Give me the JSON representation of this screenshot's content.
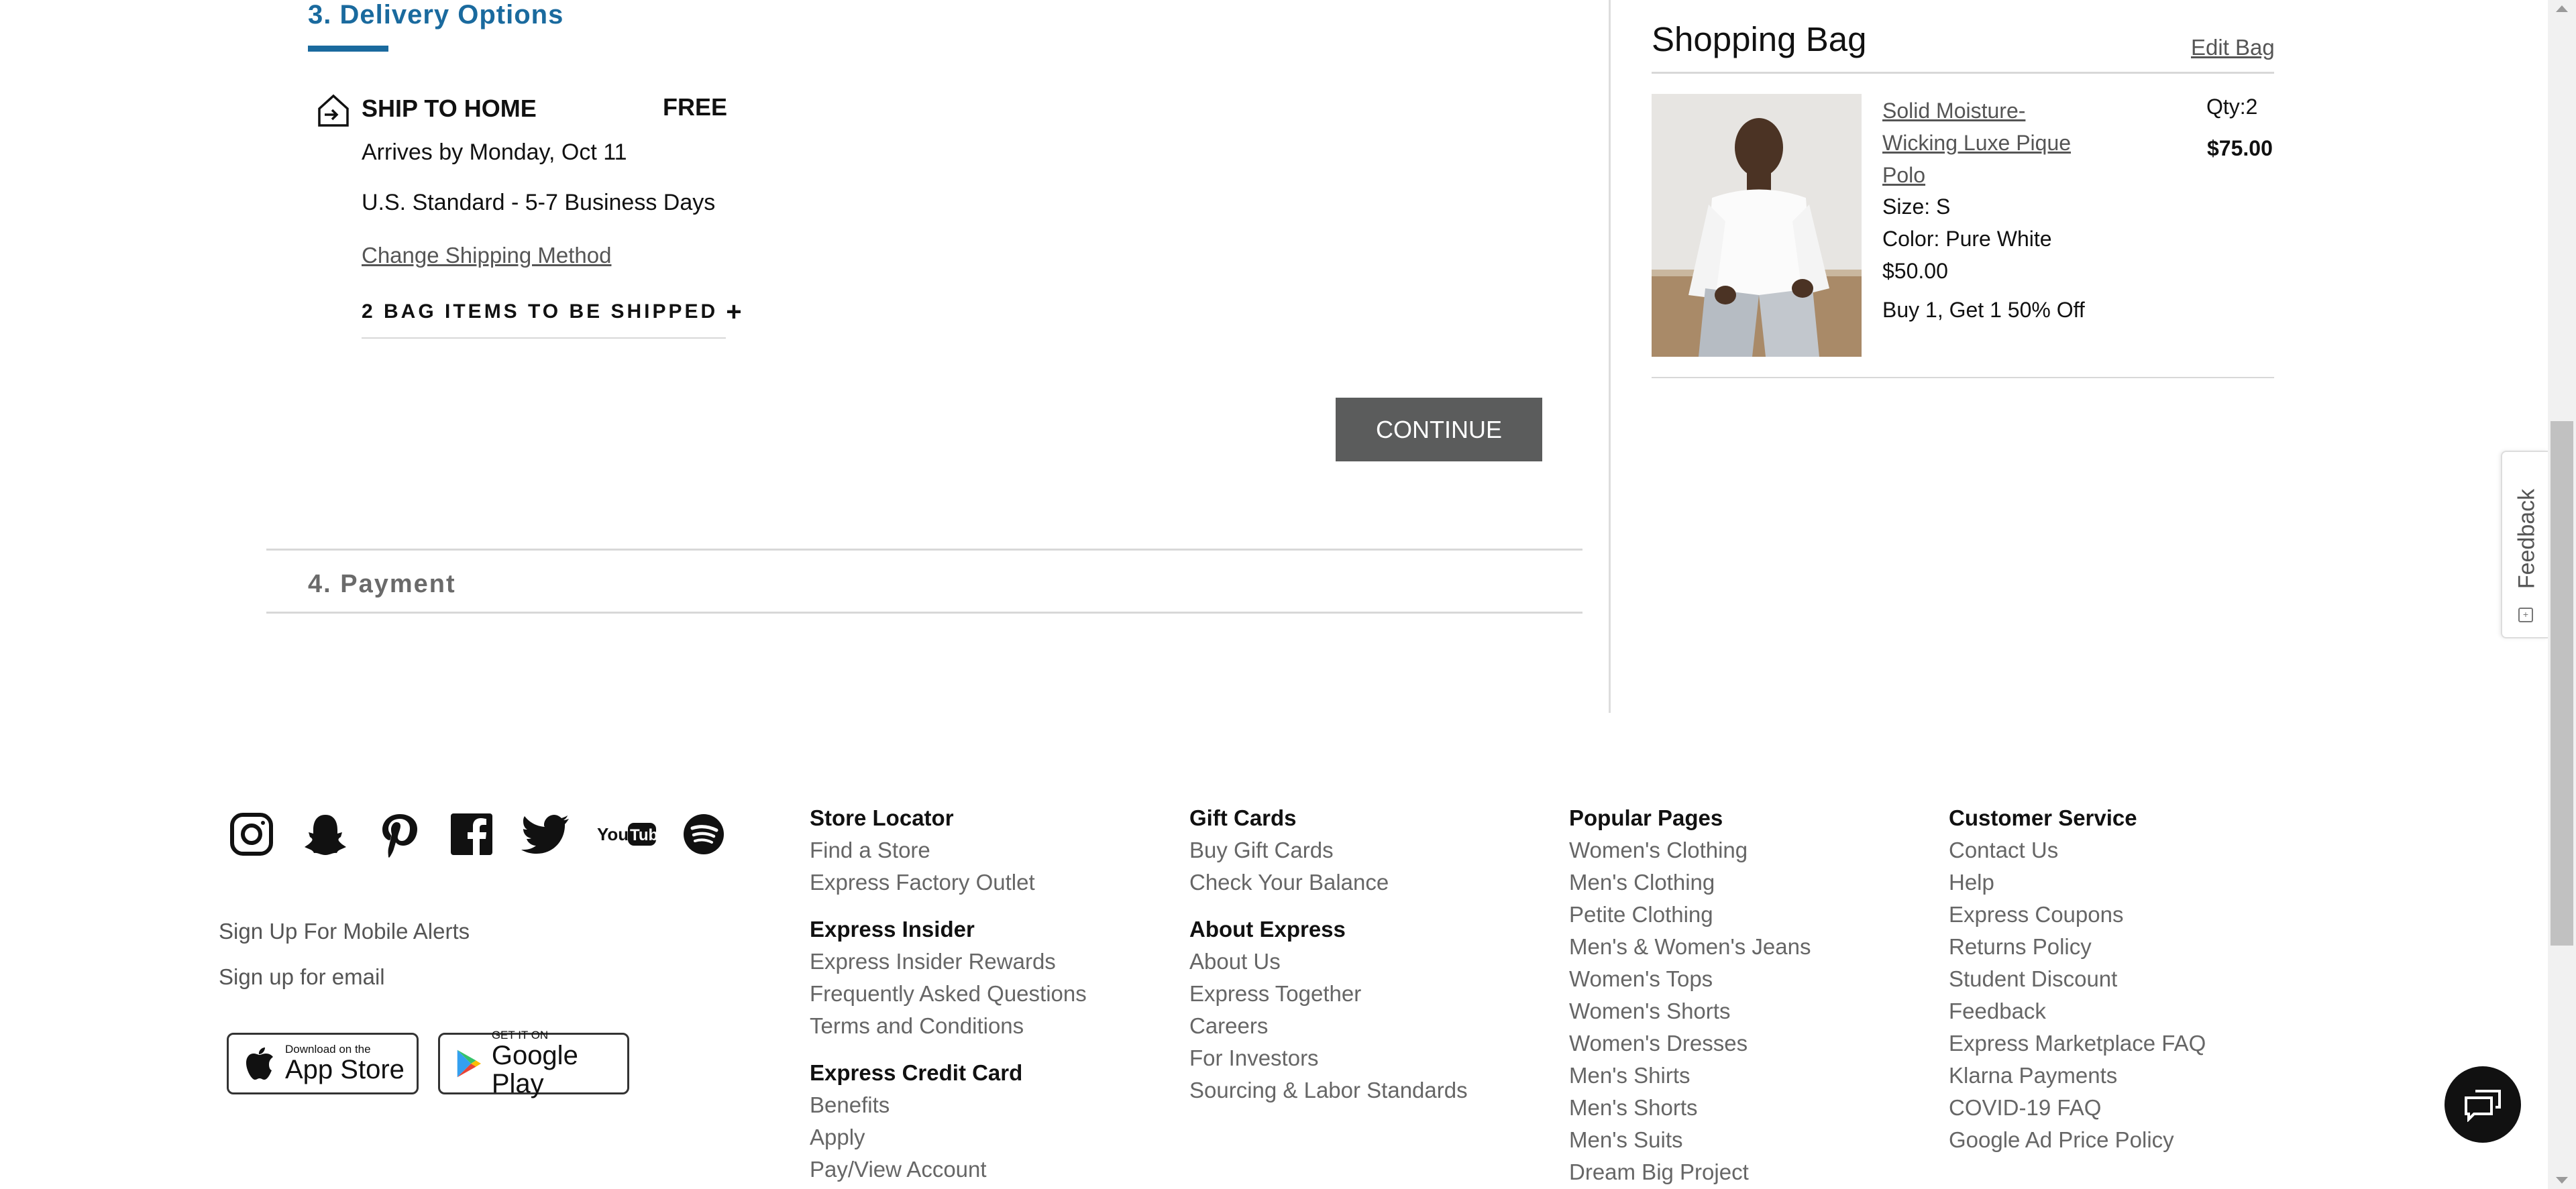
{
  "delivery": {
    "title": "3. Delivery Options",
    "ship_title": "SHIP TO HOME",
    "price": "FREE",
    "arrives": "Arrives by Monday, Oct 11",
    "method": "U.S. Standard - 5-7 Business Days",
    "change_link": "Change Shipping Method",
    "items_toggle": "2 BAG ITEMS TO BE SHIPPED",
    "continue": "CONTINUE"
  },
  "payment": {
    "title": "4. Payment"
  },
  "bag": {
    "title": "Shopping Bag",
    "edit": "Edit Bag",
    "item": {
      "name_line1": "Solid Moisture-",
      "name_line2": "Wicking Luxe Pique",
      "name_line3": "Polo",
      "size": "Size: S",
      "color": "Color: Pure White",
      "price": "$50.00",
      "promo": "Buy 1, Get 1 50% Off",
      "qty": "Qty:2",
      "total": "$75.00"
    }
  },
  "feedback": "Feedback",
  "footer": {
    "social_icons": [
      "instagram-icon",
      "snapchat-icon",
      "pinterest-icon",
      "facebook-icon",
      "twitter-icon",
      "youtube-icon",
      "spotify-icon"
    ],
    "mobile_alerts": "Sign Up For Mobile Alerts",
    "email": "Sign up for email",
    "app_store": {
      "small": "Download on the",
      "big": "App Store"
    },
    "google_play": {
      "small": "GET IT ON",
      "big": "Google Play"
    },
    "col1": {
      "store_locator": {
        "head": "Store Locator",
        "links": [
          "Find a Store",
          "Express Factory Outlet"
        ]
      },
      "insider": {
        "head": "Express Insider",
        "links": [
          "Express Insider Rewards",
          "Frequently Asked Questions",
          "Terms and Conditions"
        ]
      },
      "credit": {
        "head": "Express Credit Card",
        "links": [
          "Benefits",
          "Apply",
          "Pay/View Account"
        ]
      }
    },
    "col2": {
      "gift": {
        "head": "Gift Cards",
        "links": [
          "Buy Gift Cards",
          "Check Your Balance"
        ]
      },
      "about": {
        "head": "About Express",
        "links": [
          "About Us",
          "Express Together",
          "Careers",
          "For Investors",
          "Sourcing & Labor Standards"
        ]
      }
    },
    "col3": {
      "popular": {
        "head": "Popular Pages",
        "links": [
          "Women's Clothing",
          "Men's Clothing",
          "Petite Clothing",
          "Men's & Women's Jeans",
          "Women's Tops",
          "Women's Shorts",
          "Women's Dresses",
          "Men's Shirts",
          "Men's Shorts",
          "Men's Suits",
          "Dream Big Project"
        ]
      }
    },
    "col4": {
      "service": {
        "head": "Customer Service",
        "links": [
          "Contact Us",
          "Help",
          "Express Coupons",
          "Returns Policy",
          "Student Discount",
          "Feedback",
          "Express Marketplace FAQ",
          "Klarna Payments",
          "COVID-19 FAQ",
          "Google Ad Price Policy"
        ]
      }
    }
  }
}
